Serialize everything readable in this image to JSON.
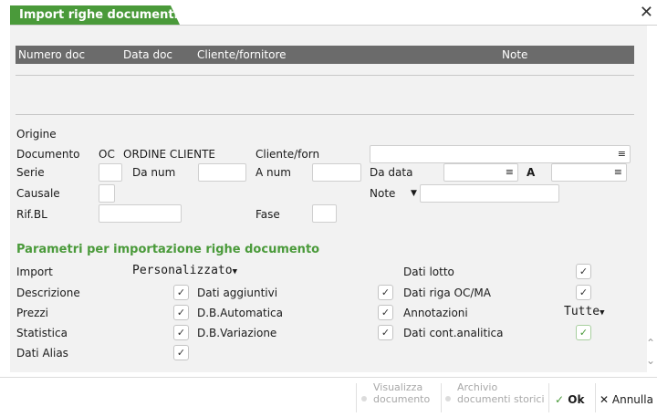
{
  "window": {
    "title": "Import righe documenti"
  },
  "grid": {
    "columns": [
      "Numero doc",
      "Data doc",
      "Cliente/fornitore",
      "Note"
    ]
  },
  "origine": {
    "heading": "Origine",
    "documento_label": "Documento",
    "documento_code": "OC",
    "documento_desc": "ORDINE CLIENTE",
    "cliente_label": "Cliente/forn",
    "serie_label": "Serie",
    "da_num_label": "Da num",
    "a_num_label": "A num",
    "da_data_label": "Da data",
    "a_label": "A",
    "causale_label": "Causale",
    "note_label": "Note",
    "rifbl_label": "Rif.BL",
    "fase_label": "Fase"
  },
  "params": {
    "heading": "Parametri per importazione righe documento",
    "import_label": "Import",
    "import_value": "Personalizzato",
    "descrizione_label": "Descrizione",
    "prezzi_label": "Prezzi",
    "statistica_label": "Statistica",
    "dati_alias_label": "Dati Alias",
    "dati_aggiuntivi_label": "Dati aggiuntivi",
    "db_automatica_label": "D.B.Automatica",
    "db_variazione_label": "D.B.Variazione",
    "dati_lotto_label": "Dati lotto",
    "dati_riga_label": "Dati riga OC/MA",
    "annotazioni_label": "Annotazioni",
    "annotazioni_value": "Tutte",
    "dati_cont_label": "Dati cont.analitica"
  },
  "footer": {
    "visualizza_line1": "Visualizza",
    "visualizza_line2": "documento",
    "archivio_line1": "Archivio",
    "archivio_line2": "documenti storici",
    "ok": "Ok",
    "annulla": "Annulla"
  },
  "colors": {
    "accent": "#4a9a3a",
    "header_bg": "#6b6b6b",
    "panel_bg": "#f2f2f2"
  }
}
